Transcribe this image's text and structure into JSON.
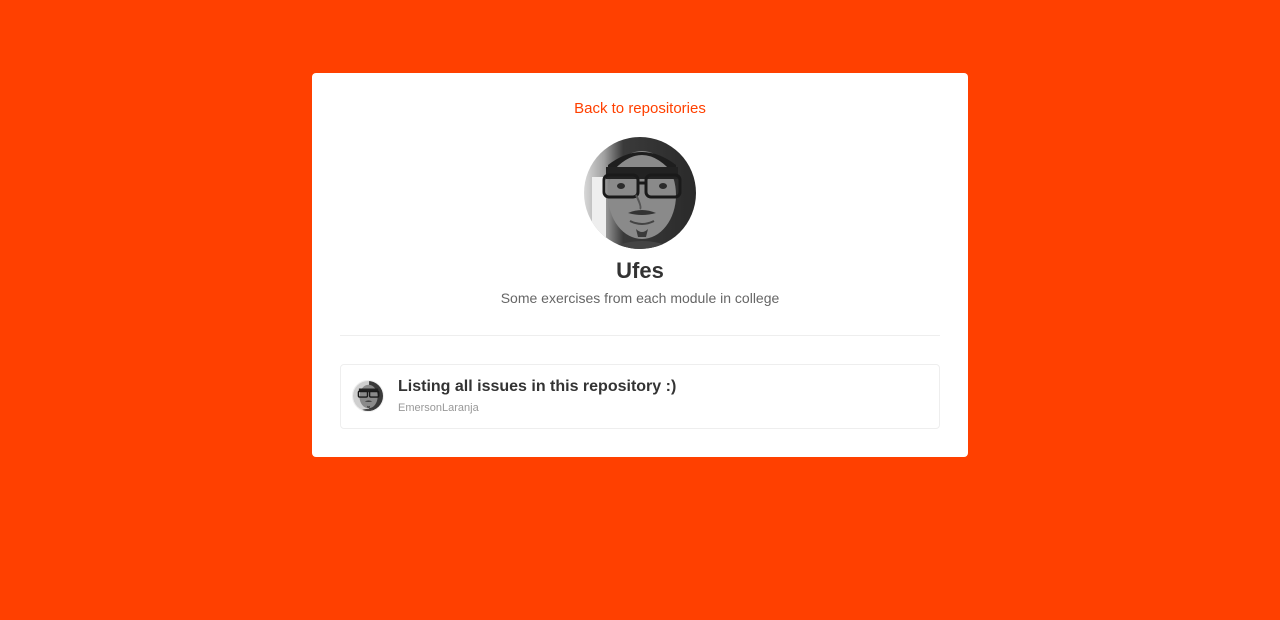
{
  "back_link": {
    "label": "Back to repositories"
  },
  "repository": {
    "name": "Ufes",
    "description": "Some exercises from each module in college",
    "owner_avatar": "profile-photo"
  },
  "issues": [
    {
      "title": "Listing all issues in this repository :)",
      "author": "EmersonLaranja",
      "avatar": "profile-photo"
    }
  ],
  "colors": {
    "background": "#ff4000",
    "link": "#ff4000",
    "card": "#ffffff",
    "title_text": "#333333",
    "description_text": "#666666",
    "muted_text": "#999999",
    "border": "#eeeeee"
  }
}
